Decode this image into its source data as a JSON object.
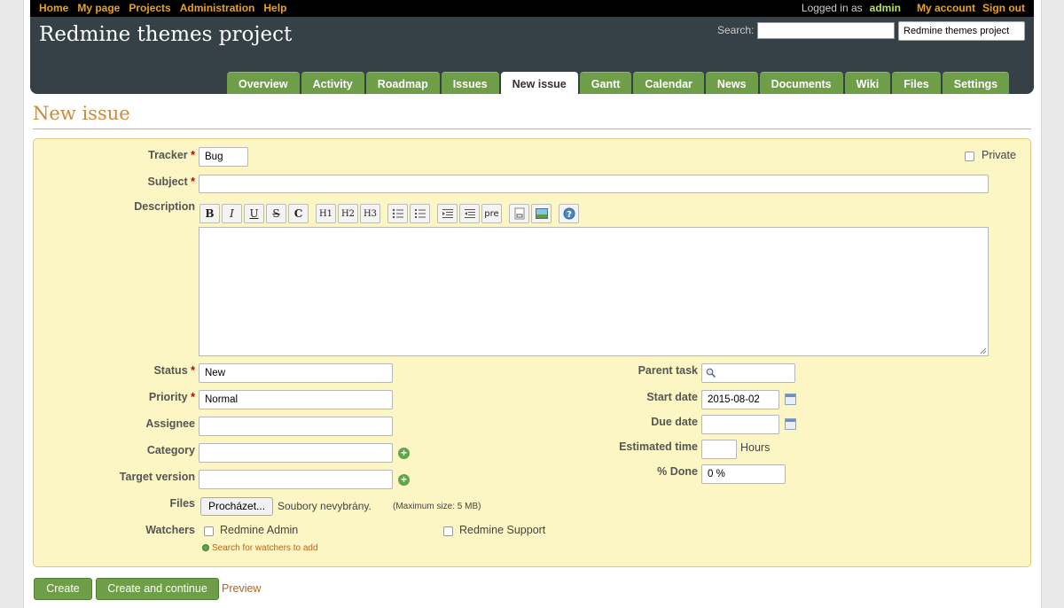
{
  "topmenu": {
    "left": [
      "Home",
      "My page",
      "Projects",
      "Administration",
      "Help"
    ],
    "logged_in_as": "Logged in as",
    "user": "admin",
    "my_account": "My account",
    "sign_out": "Sign out"
  },
  "header": {
    "title": "Redmine themes project",
    "search_label": "Search:",
    "search_value": "",
    "project_jump": "Redmine themes project"
  },
  "tabs": [
    "Overview",
    "Activity",
    "Roadmap",
    "Issues",
    "New issue",
    "Gantt",
    "Calendar",
    "News",
    "Documents",
    "Wiki",
    "Files",
    "Settings"
  ],
  "selected_tab": "New issue",
  "page": {
    "title": "New issue"
  },
  "form": {
    "tracker_label": "Tracker",
    "tracker_value": "Bug",
    "private_label": "Private",
    "subject_label": "Subject",
    "description_label": "Description",
    "toolbar": [
      "B",
      "I",
      "U",
      "S",
      "C",
      "H1",
      "H2",
      "H3",
      "pre"
    ],
    "status_label": "Status",
    "status_value": "New",
    "priority_label": "Priority",
    "priority_value": "Normal",
    "assignee_label": "Assignee",
    "category_label": "Category",
    "target_version_label": "Target version",
    "files_label": "Files",
    "browse_button": "Procházet...",
    "no_files": "Soubory nevybrány.",
    "max_size": "(Maximum size: 5 MB)",
    "watchers_label": "Watchers",
    "watcher_1": "Redmine Admin",
    "watcher_2": "Redmine Support",
    "search_watchers": "Search for watchers to add",
    "parent_task_label": "Parent task",
    "start_date_label": "Start date",
    "start_date_value": "2015-08-02",
    "due_date_label": "Due date",
    "estimated_time_label": "Estimated time",
    "hours": "Hours",
    "done_label": "% Done",
    "done_value": "0 %",
    "required_mark": "*"
  },
  "buttons": {
    "create": "Create",
    "create_continue": "Create and continue",
    "preview": "Preview"
  }
}
